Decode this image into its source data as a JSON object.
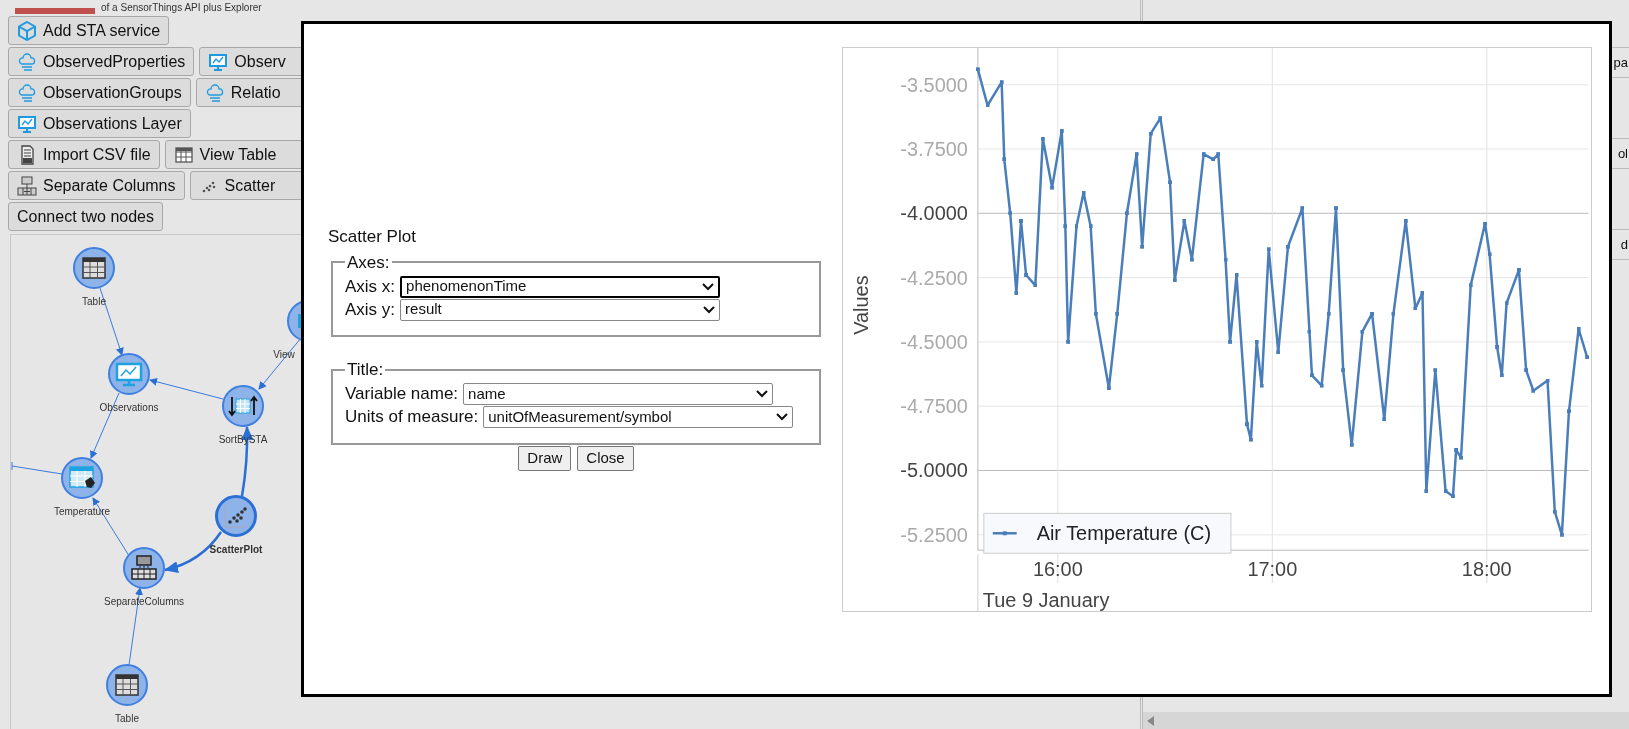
{
  "header": {
    "subtitle": "of a SensorThings API plus Explorer"
  },
  "toolbar_rows": [
    [
      "Add STA service"
    ],
    [
      "ObservedProperties",
      "Observ"
    ],
    [
      "ObservationGroups",
      "Relatio"
    ],
    [
      "Observations Layer"
    ],
    [
      "Import CSV file",
      "View Table"
    ],
    [
      "Separate Columns",
      "Scatter"
    ],
    [
      "Connect two nodes"
    ]
  ],
  "graph": {
    "nodes": [
      {
        "label": "Table",
        "selected": false
      },
      {
        "label": "Observations",
        "selected": false
      },
      {
        "label": "SortBySTA",
        "selected": false
      },
      {
        "label": "View",
        "selected": false
      },
      {
        "label": "Temperature",
        "selected": false
      },
      {
        "label": "ScatterPlot",
        "selected": true
      },
      {
        "label": "SeparateColumns",
        "selected": false
      },
      {
        "label": "Table",
        "selected": false
      }
    ]
  },
  "right_panel": {
    "rows": [
      "pa",
      "ol",
      "d"
    ]
  },
  "dialog": {
    "title": "Scatter Plot",
    "fieldsets": [
      {
        "legend": "Axes:",
        "fields": [
          {
            "label": "Axis x:",
            "value": "phenomenonTime",
            "focused": true
          },
          {
            "label": "Axis y:",
            "value": "result",
            "focused": false
          }
        ]
      },
      {
        "legend": "Title:",
        "fields": [
          {
            "label": "Variable name:",
            "value": "name",
            "focused": false
          },
          {
            "label": "Units of measure:",
            "value": "unitOfMeasurement/symbol",
            "focused": false
          }
        ]
      }
    ],
    "buttons": [
      "Draw",
      "Close"
    ],
    "chart_data": {
      "type": "line",
      "xlabel": "Tue 9 January",
      "ylabel": "Values",
      "x": [
        15.627,
        15.672,
        15.738,
        15.75,
        15.778,
        15.807,
        15.828,
        15.852,
        15.895,
        15.93,
        15.973,
        16.018,
        16.035,
        16.048,
        16.087,
        16.12,
        16.153,
        16.177,
        16.238,
        16.277,
        16.322,
        16.367,
        16.393,
        16.433,
        16.478,
        16.523,
        16.545,
        16.59,
        16.625,
        16.68,
        16.725,
        16.748,
        16.782,
        16.803,
        16.833,
        16.882,
        16.9,
        16.927,
        16.95,
        16.983,
        17.028,
        17.073,
        17.14,
        17.173,
        17.185,
        17.23,
        17.263,
        17.297,
        17.33,
        17.37,
        17.42,
        17.465,
        17.522,
        17.565,
        17.622,
        17.667,
        17.7,
        17.718,
        17.76,
        17.808,
        17.842,
        17.857,
        17.88,
        17.925,
        17.992,
        18.013,
        18.048,
        18.07,
        18.092,
        18.15,
        18.183,
        18.217,
        18.283,
        18.317,
        18.35,
        18.383,
        18.428,
        18.468
      ],
      "series": [
        {
          "name": "Air Temperature (C)",
          "color": "#4a7ebb",
          "values": [
            -3.44,
            -3.58,
            -3.49,
            -3.79,
            -4.0,
            -4.31,
            -4.03,
            -4.24,
            -4.28,
            -3.71,
            -3.9,
            -3.68,
            -4.05,
            -4.5,
            -4.05,
            -3.92,
            -4.05,
            -4.39,
            -4.68,
            -4.39,
            -4.0,
            -3.77,
            -4.13,
            -3.69,
            -3.63,
            -3.88,
            -4.26,
            -4.03,
            -4.18,
            -3.77,
            -3.79,
            -3.77,
            -4.18,
            -4.5,
            -4.24,
            -4.82,
            -4.88,
            -4.5,
            -4.67,
            -4.14,
            -4.54,
            -4.13,
            -3.98,
            -4.46,
            -4.63,
            -4.67,
            -4.39,
            -3.98,
            -4.61,
            -4.9,
            -4.46,
            -4.39,
            -4.8,
            -4.39,
            -4.03,
            -4.37,
            -4.31,
            -5.08,
            -4.61,
            -5.08,
            -5.1,
            -4.92,
            -4.95,
            -4.28,
            -4.04,
            -4.16,
            -4.52,
            -4.63,
            -4.35,
            -4.22,
            -4.61,
            -4.69,
            -4.65,
            -5.16,
            -5.25,
            -4.77,
            -4.45,
            -4.56
          ]
        }
      ],
      "grid": true,
      "xlim": [
        15.627,
        18.475
      ],
      "ylim": [
        -5.31,
        -3.365
      ],
      "xticks": [
        {
          "value": 16,
          "label": "16:00"
        },
        {
          "value": 17,
          "label": "17:00"
        },
        {
          "value": 18,
          "label": "18:00"
        }
      ],
      "yticks": [
        {
          "value": -3.5,
          "label": "-3.5000"
        },
        {
          "value": -3.75,
          "label": "-3.7500"
        },
        {
          "value": -4,
          "label": "-4.0000"
        },
        {
          "value": -4.25,
          "label": "-4.2500"
        },
        {
          "value": -4.5,
          "label": "-4.5000"
        },
        {
          "value": -4.75,
          "label": "-4.7500"
        },
        {
          "value": -5,
          "label": "-5.0000"
        },
        {
          "value": -5.25,
          "label": "-5.2500"
        }
      ]
    }
  }
}
